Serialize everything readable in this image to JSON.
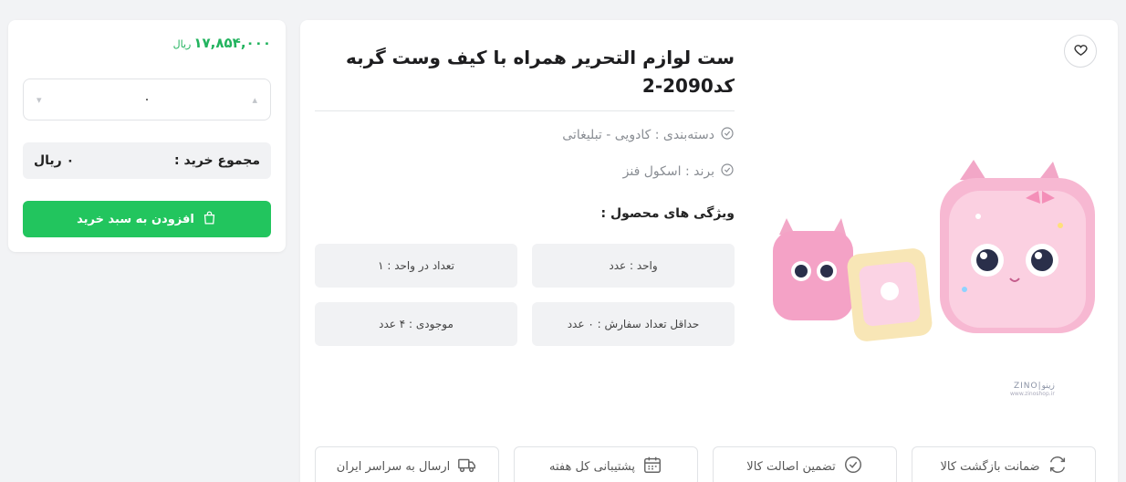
{
  "cart": {
    "price": "۱۷,۸۵۴,۰۰۰",
    "price_unit": "ریال",
    "quantity": "۰",
    "total_label": "مجموع خرید :",
    "total_value": "۰ ریال",
    "add_to_cart_label": "افزودن به سبد خرید"
  },
  "product": {
    "title": "ست لوازم التحریر همراه با کیف وست گربه کد2090-2",
    "category": "دسته‌بندی : کادویی - تبلیغاتی",
    "brand": "برند : اسکول فنز",
    "features_title": "ویژگی های محصول :",
    "features": [
      "واحد : عدد",
      "تعداد در واحد : ۱",
      "حداقل تعداد سفارش : ۰ عدد",
      "موجودی : ۴ عدد"
    ],
    "image_logo": "ZINO|زینو",
    "image_logo_sub": "www.zinoshop.ir"
  },
  "badges": [
    "ضمانت بازگشت کالا",
    "تضمین اصالت کالا",
    "پشتیبانی کل هفته",
    "ارسال به سراسر ایران"
  ],
  "colors": {
    "accent_green": "#22c55e",
    "price_green": "#22b35e",
    "bag_pink": "#f3a5c9"
  },
  "icons": [
    "heart-icon",
    "check-circle-icon",
    "shopping-bag-icon",
    "refresh-icon",
    "shield-check-icon",
    "calendar-icon",
    "truck-icon",
    "stepper-up-icon",
    "stepper-down-icon"
  ]
}
